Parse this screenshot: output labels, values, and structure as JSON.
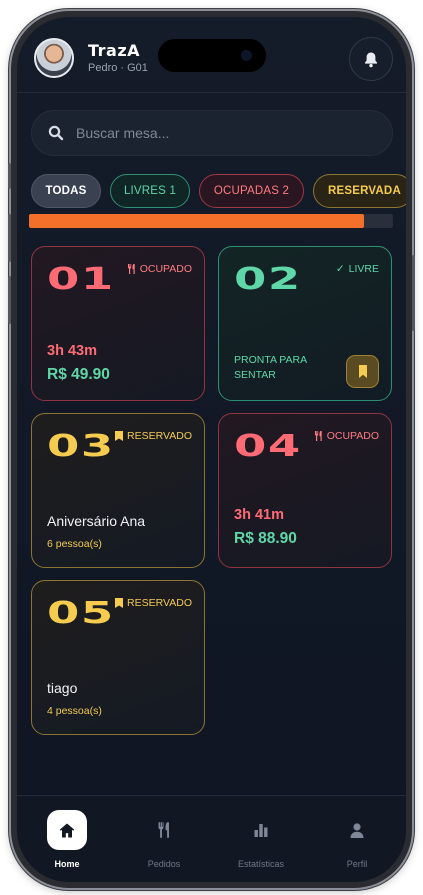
{
  "header": {
    "app_name": "TrazA",
    "user_line": "Pedro · G01"
  },
  "search": {
    "placeholder": "Buscar mesa..."
  },
  "filters": [
    {
      "label": "TODAS"
    },
    {
      "label": "LIVRES 1"
    },
    {
      "label": "OCUPADAS 2"
    },
    {
      "label": "RESERVADA"
    }
  ],
  "occupancy_progress_fraction": 0.92,
  "tables": [
    {
      "number": "01",
      "status": "OCUPADO",
      "time": "3h 43m",
      "total": "R$ 49.90"
    },
    {
      "number": "02",
      "status": "LIVRE",
      "note_line1": "PRONTA PARA",
      "note_line2": "SENTAR"
    },
    {
      "number": "03",
      "status": "RESERVADO",
      "reservation_name": "Aniversário Ana",
      "people": "6 pessoa(s)"
    },
    {
      "number": "04",
      "status": "OCUPADO",
      "time": "3h 41m",
      "total": "R$ 88.90"
    },
    {
      "number": "05",
      "status": "RESERVADO",
      "reservation_name": "tiago",
      "people": "4 pessoa(s)"
    }
  ],
  "nav": [
    {
      "label": "Home",
      "icon": "home-icon"
    },
    {
      "label": "Pedidos",
      "icon": "fork-knife-icon"
    },
    {
      "label": "Estatísticas",
      "icon": "bar-chart-icon"
    },
    {
      "label": "Perfil",
      "icon": "person-icon"
    }
  ],
  "colors": {
    "background": "#121826",
    "occupied": "#ff6b75",
    "free": "#5fd7a8",
    "reserved": "#f5cc4f",
    "progress": "#f2702a"
  }
}
